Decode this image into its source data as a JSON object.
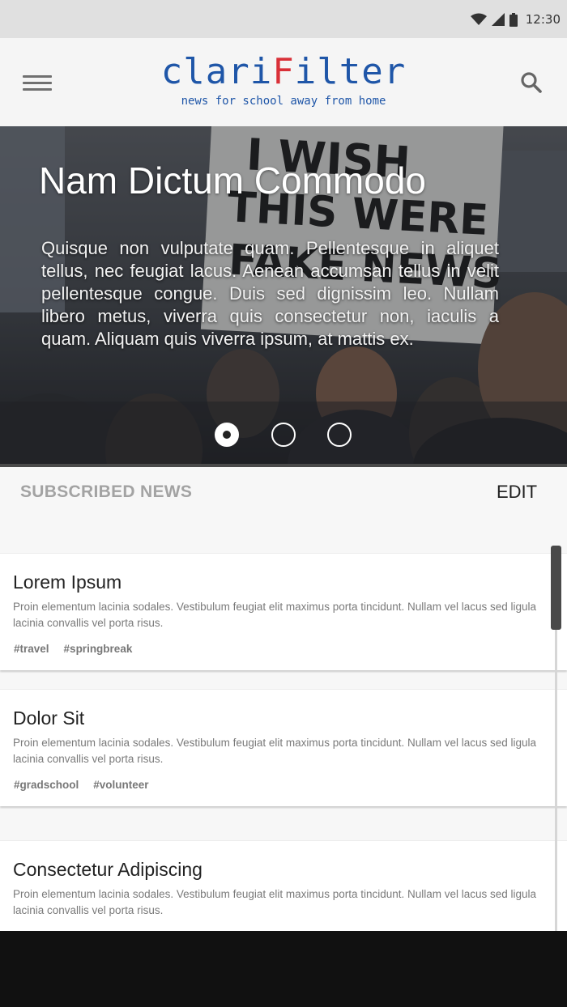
{
  "status_bar": {
    "time": "12:30"
  },
  "app_bar": {
    "logo_part1": "clari",
    "logo_accent": "F",
    "logo_part2": "ilter",
    "tagline": "news for school away from home"
  },
  "hero": {
    "title": "Nam Dictum Commodo",
    "text": "Quisque non vulputate quam. Pellentesque in aliquet tellus, nec feugiat lacus. Aenean accumsan tellus in velit pellentesque congue. Duis sed dignissim leo. Nullam libero metus, viverra quis consectetur non, iaculis a quam. Aliquam quis viverra ipsum, at mattis ex.",
    "slides": 3,
    "active_slide": 1,
    "sign_lines": [
      "I WISH",
      "THIS WERE",
      "FAKE NEWS"
    ]
  },
  "subscribed": {
    "title": "SUBSCRIBED NEWS",
    "edit_label": "EDIT",
    "cards": [
      {
        "title": "Lorem Ipsum",
        "body": "Proin elementum lacinia sodales. Vestibulum feugiat elit maximus porta tincidunt. Nullam vel lacus sed ligula lacinia convallis vel porta risus.",
        "tags": [
          "#travel",
          "#springbreak"
        ]
      },
      {
        "title": "Dolor Sit",
        "body": "Proin elementum lacinia sodales. Vestibulum feugiat elit maximus porta tincidunt. Nullam vel lacus sed ligula lacinia convallis vel porta risus.",
        "tags": [
          "#gradschool",
          "#volunteer"
        ]
      },
      {
        "title": "Consectetur Adipiscing",
        "body": "Proin elementum lacinia sodales. Vestibulum feugiat elit maximus porta tincidunt. Nullam vel lacus sed ligula lacinia convallis vel porta risus.",
        "tags": []
      }
    ]
  },
  "colors": {
    "brand_blue": "#1f56a8",
    "brand_red": "#d93038"
  },
  "icons": [
    "wifi-icon",
    "signal-icon",
    "battery-icon",
    "menu-icon",
    "search-icon"
  ]
}
